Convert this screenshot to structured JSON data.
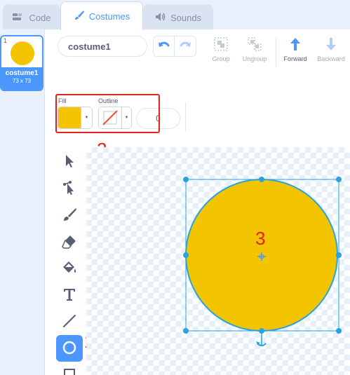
{
  "tabs": [
    {
      "label": "Code",
      "icon": "code-icon"
    },
    {
      "label": "Costumes",
      "icon": "brush-icon"
    },
    {
      "label": "Sounds",
      "icon": "speaker-icon"
    }
  ],
  "costume_list": {
    "items": [
      {
        "number": "1",
        "name": "costume1",
        "size": "73 x 73"
      }
    ]
  },
  "editor": {
    "costume_name": "costume1",
    "toolbar": {
      "group_label": "Group",
      "ungroup_label": "Ungroup",
      "forward_label": "Forward",
      "backward_label": "Backward"
    },
    "fill_label": "Fill",
    "outline_label": "Outline",
    "outline_width": "0",
    "fill_color": "#f2c500"
  },
  "annotations": {
    "one": "1",
    "two": "2",
    "three": "3"
  },
  "colors": {
    "accent": "#4c97ff",
    "annotation_red": "#e3231a",
    "shape_fill": "#f2c500",
    "selection": "#29a3dd"
  }
}
